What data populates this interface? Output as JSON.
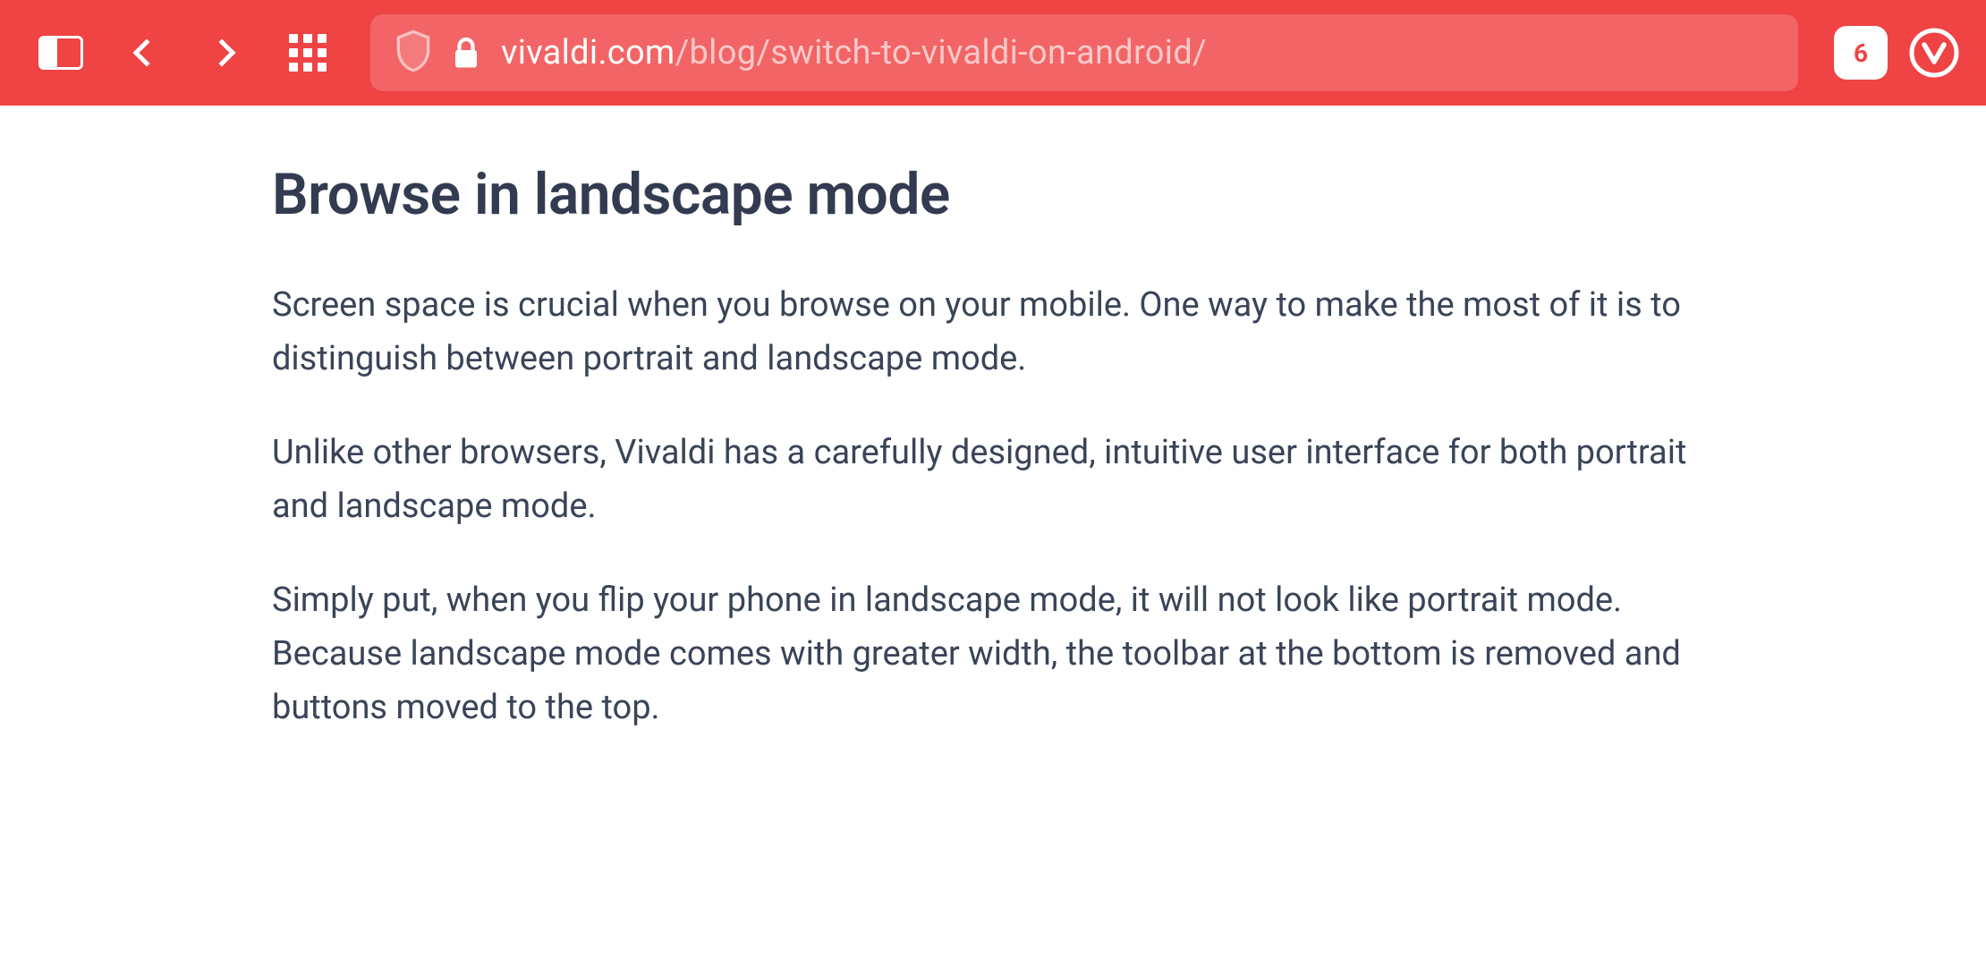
{
  "toolbar": {
    "url_domain": "vivaldi.com",
    "url_path": "/blog/switch-to-vivaldi-on-android/",
    "tab_count": "6"
  },
  "content": {
    "heading": "Browse in landscape mode",
    "paragraphs": [
      "Screen space is crucial when you browse on your mobile. One way to make the most of it is to distinguish between portrait and landscape mode.",
      "Unlike other browsers, Vivaldi has a carefully designed, intuitive user interface for both portrait and landscape mode.",
      "Simply put, when you flip your phone in landscape mode, it will not look like portrait mode. Because landscape mode comes with greater width, the toolbar at the bottom is removed and buttons moved to the top."
    ]
  },
  "colors": {
    "brand_red": "#ef4344",
    "text_dark": "#323b50"
  }
}
